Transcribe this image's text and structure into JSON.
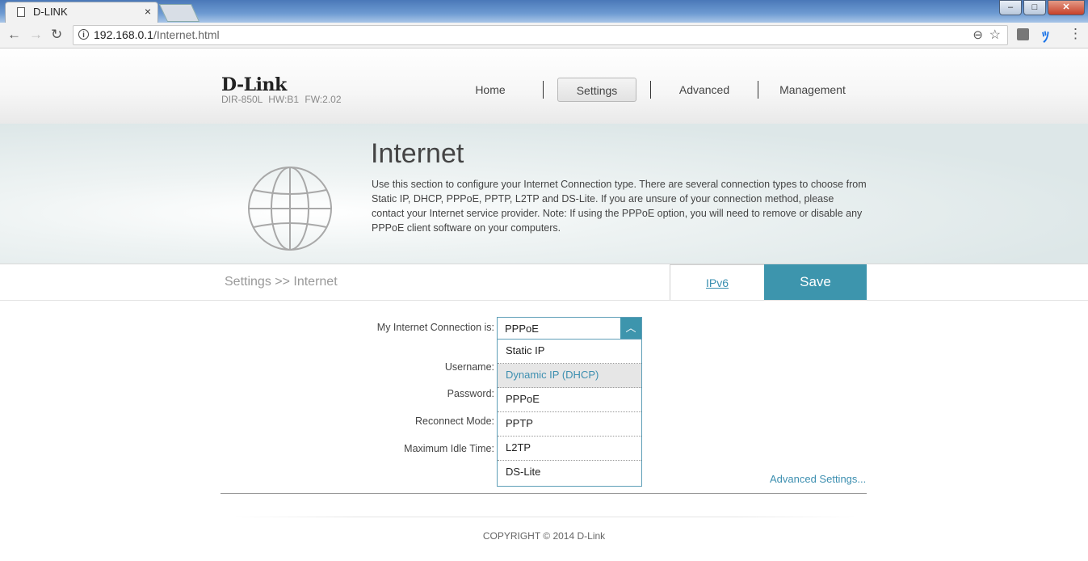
{
  "browser": {
    "tab_title": "D-LINK",
    "tab_close": "×",
    "url_host": "192.168.0.1",
    "url_path": "/Internet.html",
    "win_min": "–",
    "win_max": "□",
    "win_close": "✕"
  },
  "header": {
    "logo": "D-Link",
    "model": "DIR-850L HW:B1 FW:2.02",
    "nav": [
      {
        "label": "Home"
      },
      {
        "label": "Settings"
      },
      {
        "label": "Advanced"
      },
      {
        "label": "Management"
      }
    ],
    "active_nav": "Settings"
  },
  "banner": {
    "title": "Internet",
    "description": "Use this section to configure your Internet Connection type. There are several connection types to choose from Static IP, DHCP, PPPoE, PPTP, L2TP and DS-Lite. If you are unsure of your connection method, please contact your Internet service provider. Note: If using the PPPoE option, you will need to remove or disable any PPPoE client software on your computers."
  },
  "breadcrumb": "Settings >> Internet",
  "actions": {
    "ipv6_label": "IPv6",
    "save_label": "Save"
  },
  "form": {
    "connection_label": "My Internet Connection is:",
    "connection_value": "PPPoE",
    "username_label": "Username:",
    "password_label": "Password:",
    "reconnect_label": "Reconnect Mode:",
    "idle_label": "Maximum Idle Time:",
    "options": [
      "Static IP",
      "Dynamic IP (DHCP)",
      "PPPoE",
      "PPTP",
      "L2TP",
      "DS-Lite"
    ],
    "hovered_option": "Dynamic IP (DHCP)",
    "advanced_settings": "Advanced Settings..."
  },
  "footer": {
    "copyright": "COPYRIGHT © 2014 D-Link"
  },
  "colors": {
    "accent": "#3d95ad",
    "link": "#3d8fb0"
  }
}
